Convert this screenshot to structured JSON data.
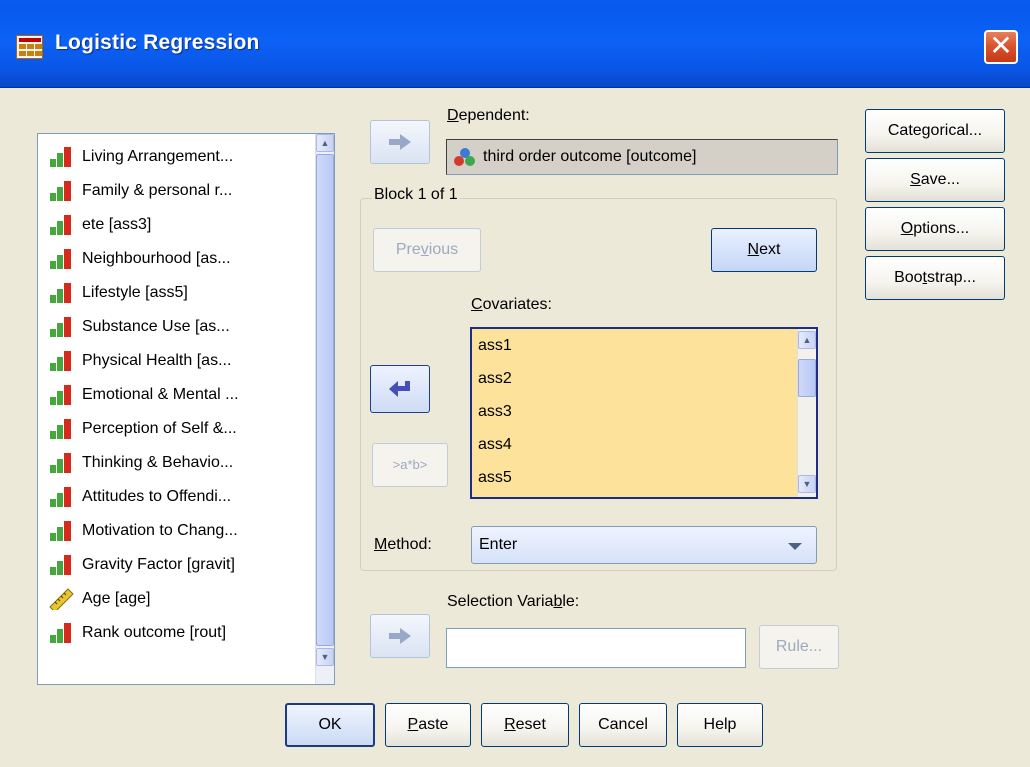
{
  "window": {
    "title": "Logistic Regression",
    "close_label": "✕"
  },
  "variables": {
    "items": [
      {
        "label": "Living Arrangement...",
        "icon": "ordinal-icon"
      },
      {
        "label": "Family & personal r...",
        "icon": "ordinal-icon"
      },
      {
        "label": "ete [ass3]",
        "icon": "ordinal-icon"
      },
      {
        "label": "Neighbourhood [as...",
        "icon": "ordinal-icon"
      },
      {
        "label": "Lifestyle [ass5]",
        "icon": "ordinal-icon"
      },
      {
        "label": "Substance Use [as...",
        "icon": "ordinal-icon"
      },
      {
        "label": "Physical Health [as...",
        "icon": "ordinal-icon"
      },
      {
        "label": "Emotional & Mental ...",
        "icon": "ordinal-icon"
      },
      {
        "label": "Perception of Self &...",
        "icon": "ordinal-icon"
      },
      {
        "label": "Thinking & Behavio...",
        "icon": "ordinal-icon"
      },
      {
        "label": "Attitudes to Offendi...",
        "icon": "ordinal-icon"
      },
      {
        "label": "Motivation to Chang...",
        "icon": "ordinal-icon"
      },
      {
        "label": "Gravity Factor [gravit]",
        "icon": "ordinal-icon"
      },
      {
        "label": "Age [age]",
        "icon": "scale-icon"
      },
      {
        "label": "Rank outcome [rout]",
        "icon": "ordinal-icon"
      }
    ]
  },
  "dependent": {
    "label_prefix": "",
    "label_ul": "D",
    "label_rest": "ependent:",
    "value": "third order outcome [outcome]",
    "icon": "nominal-icon"
  },
  "block": {
    "title": "Block 1 of 1",
    "previous_pre": "Pre",
    "previous_ul": "v",
    "previous_post": "ious",
    "next_ul": "N",
    "next_post": "ext"
  },
  "covariates": {
    "label_ul": "C",
    "label_rest": "ovariates:",
    "items": [
      "ass1",
      "ass2",
      "ass3",
      "ass4",
      "ass5"
    ],
    "interaction_label": ">a*b>"
  },
  "method": {
    "label_ul": "M",
    "label_rest": "ethod:",
    "value": "Enter"
  },
  "selection": {
    "label_pre": "Selection Varia",
    "label_ul": "b",
    "label_post": "le:",
    "value": "",
    "rule_label": "Rule..."
  },
  "side_buttons": {
    "categorical": "Categorical...",
    "save_ul": "S",
    "save_post": "ave...",
    "options_ul": "O",
    "options_post": "ptions...",
    "bootstrap_pre": "Boo",
    "bootstrap_ul": "t",
    "bootstrap_post": "strap..."
  },
  "bottom_buttons": {
    "ok": "OK",
    "paste_ul": "P",
    "paste_post": "aste",
    "reset_ul": "R",
    "reset_post": "eset",
    "cancel": "Cancel",
    "help": "Help"
  },
  "colors": {
    "titlebar": "#0a5cf1",
    "covariates_bg": "#fde29c",
    "dialog_bg": "#ece9d8"
  }
}
